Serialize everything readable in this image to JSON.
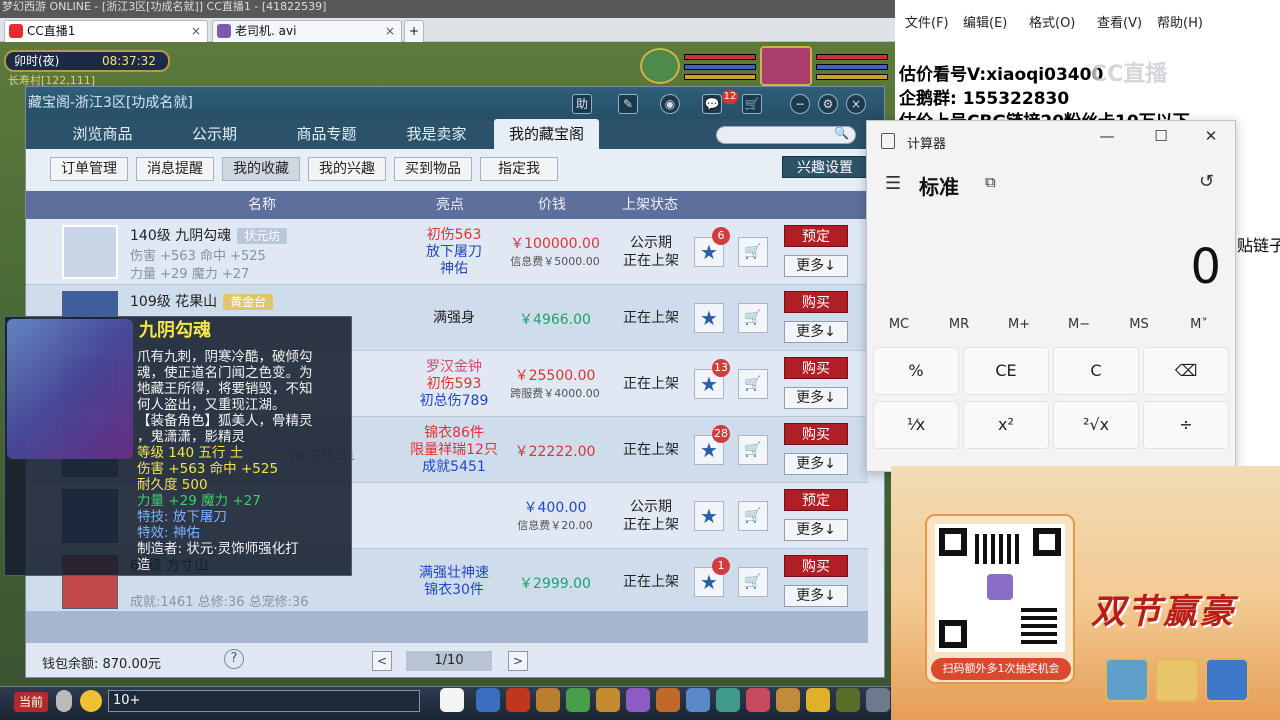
{
  "topstrip": "梦幻西游 ONLINE - [浙江3区[功成名就]]   CC直播1 - [41822539]",
  "browser_tabs": [
    {
      "label": "CC直播1",
      "close": "×"
    },
    {
      "label": "老司机. avi",
      "close": "×"
    },
    {
      "label": "+"
    }
  ],
  "hud": {
    "time_label": "卯时(夜)",
    "clock": "08:37:32",
    "map": "长寿村[122,111]"
  },
  "window": {
    "title": "藏宝阁-浙江3区[功成名就]",
    "title_buttons": [
      "助",
      "✎",
      "◉",
      "💬",
      "🛒",
      "−",
      "⚙",
      "×"
    ],
    "message_badge": "12",
    "nav_tabs": [
      "浏览商品",
      "公示期",
      "商品专题",
      "我是卖家",
      "我的藏宝阁"
    ],
    "sub_tabs": [
      "订单管理",
      "消息提醒",
      "我的收藏",
      "我的兴趣",
      "买到物品",
      "指定我"
    ],
    "interest_button": "兴趣设置",
    "columns": [
      "名称",
      "亮点",
      "价钱",
      "上架状态"
    ],
    "rows": [
      {
        "name": "140级 九阴勾魂",
        "server": "状元坊",
        "line2": "伤害 +563 命中 +525",
        "line3": "力量 +29 魔力 +27",
        "hl": [
          "初伤563",
          "放下屠刀",
          "神佑"
        ],
        "price": "￥100000.00",
        "fee": "信息费￥5000.00",
        "status": [
          "公示期",
          "正在上架"
        ],
        "badge": "6",
        "action": "预定",
        "more": "更多↓"
      },
      {
        "name": "109级 花果山",
        "server": "黄金台",
        "line2": "",
        "line3": "",
        "hl": [
          "满强身"
        ],
        "price": "￥4966.00",
        "fee": "",
        "status": [
          "正在上架"
        ],
        "badge": "",
        "action": "购买",
        "more": "更多↓"
      },
      {
        "name": "",
        "server": "",
        "line2": "",
        "line3": "",
        "hl": [
          "罗汉金钟",
          "初伤593",
          "初总伤789"
        ],
        "price": "￥25500.00",
        "fee": "跨服费￥4000.00",
        "status": [
          "正在上架"
        ],
        "badge": "13",
        "action": "购买",
        "more": "更多↓"
      },
      {
        "name": "",
        "server": "",
        "line2": "",
        "line3": "76 总修:51",
        "hl": [
          "锦衣86件",
          "限量祥瑞12只",
          "成就5451"
        ],
        "price": "￥22222.00",
        "fee": "",
        "status": [
          "正在上架"
        ],
        "badge": "28",
        "action": "购买",
        "more": "更多↓"
      },
      {
        "name": "",
        "server": "",
        "line2": "",
        "line3": "",
        "hl": [],
        "price": "￥400.00",
        "fee": "信息费￥20.00",
        "status": [
          "公示期",
          "正在上架"
        ],
        "badge": "",
        "action": "预定",
        "more": "更多↓"
      },
      {
        "name": "69级 方寸山",
        "server": "",
        "line2": "",
        "line3": "成就:1461 总修:36 总宠修:36",
        "hl": [
          "满强壮神速",
          "锦衣30件"
        ],
        "price": "￥2999.00",
        "fee": "",
        "status": [
          "正在上架"
        ],
        "badge": "1",
        "action": "购买",
        "more": "更多↓"
      }
    ],
    "wallet": "钱包余额: 870.00元",
    "help": "?",
    "page": "1/10",
    "prev": "<",
    "next": ">"
  },
  "tooltip": {
    "title": "九阴勾魂",
    "desc": [
      "爪有九刺，阴寒冷酷，破倾勾",
      "魂，使正道名门闻之色变。为",
      "地藏王所得，将要销毁，不知",
      "何人盗出，又重现江湖。"
    ],
    "role": "【装备角色】狐美人，骨精灵",
    "role2": "，鬼潇潇，影精灵",
    "level": "等级 140  五行 土",
    "dmg": "伤害 +563 命中 +525",
    "dur": "耐久度 500",
    "attr": "力量 +29 魔力 +27",
    "skill": "特技: 放下屠刀",
    "effect": "特效: 神佑",
    "maker": "制造者: 状元·灵饰师强化打",
    "maker2": "造"
  },
  "gamebar": {
    "channel": "当前",
    "chat": "10+"
  },
  "notepad": {
    "menu": [
      "文件(F)",
      "编辑(E)",
      "格式(O)",
      "查看(V)",
      "帮助(H)"
    ],
    "lines": [
      "估价看号V:xiaoqi03400",
      "企鹅群: 155322830",
      "估价上号CBG链接20粉丝卡10万以下"
    ],
    "side": "贴链子",
    "watermark": "CC直播"
  },
  "calculator": {
    "title": "计算器",
    "mode": "标准",
    "display": "0",
    "memory": [
      "MC",
      "MR",
      "M+",
      "M−",
      "MS",
      "M˅"
    ],
    "keys": [
      "%",
      "CE",
      "C",
      "⌫",
      "¹⁄x",
      "x²",
      "²√x",
      "÷"
    ]
  },
  "ad": {
    "banner": "扫码额外多1次抽奖机会",
    "title": "双节赢豪"
  }
}
